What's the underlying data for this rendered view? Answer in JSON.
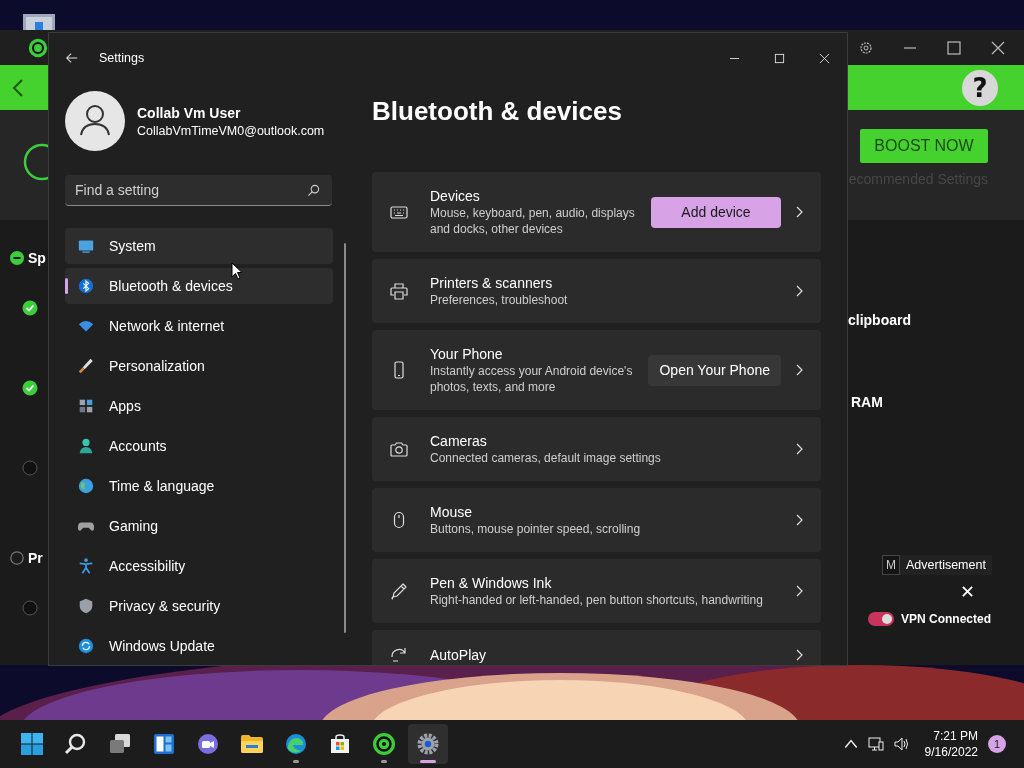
{
  "background_app": {
    "help": "?",
    "boost_button": "BOOST NOW",
    "recommended_link": "ecommended Settings",
    "sections": [
      {
        "label": "Sp",
        "indeterminate": true,
        "items": [
          {
            "checked": true
          },
          {
            "checked": true
          },
          {
            "checked": false
          }
        ]
      },
      {
        "label": "Pr",
        "indeterminate": false,
        "items": [
          {
            "checked": false
          }
        ]
      }
    ],
    "right_texts": [
      "clipboard",
      "RAM"
    ],
    "ad": {
      "label": "Advertisement",
      "button": "M"
    },
    "vpn": {
      "label": "VPN Connected",
      "on": true
    }
  },
  "settings_window": {
    "title": "Settings",
    "user": {
      "name": "Collab Vm User",
      "email": "CollabVmTimeVM0@outlook.com"
    },
    "search": {
      "placeholder": "Find a setting"
    },
    "nav": [
      {
        "label": "System",
        "selected": false,
        "hovered": true
      },
      {
        "label": "Bluetooth & devices",
        "selected": true,
        "hovered": false
      },
      {
        "label": "Network & internet",
        "selected": false,
        "hovered": false
      },
      {
        "label": "Personalization",
        "selected": false,
        "hovered": false
      },
      {
        "label": "Apps",
        "selected": false,
        "hovered": false
      },
      {
        "label": "Accounts",
        "selected": false,
        "hovered": false
      },
      {
        "label": "Time & language",
        "selected": false,
        "hovered": false
      },
      {
        "label": "Gaming",
        "selected": false,
        "hovered": false
      },
      {
        "label": "Accessibility",
        "selected": false,
        "hovered": false
      },
      {
        "label": "Privacy & security",
        "selected": false,
        "hovered": false
      },
      {
        "label": "Windows Update",
        "selected": false,
        "hovered": false
      }
    ],
    "heading": "Bluetooth & devices",
    "cards": [
      {
        "title": "Devices",
        "subtitle": "Mouse, keyboard, pen, audio, displays and docks, other devices",
        "button": {
          "label": "Add device",
          "kind": "accent"
        }
      },
      {
        "title": "Printers & scanners",
        "subtitle": "Preferences, troubleshoot"
      },
      {
        "title": "Your Phone",
        "subtitle": "Instantly access your Android device's photos, texts, and more",
        "button": {
          "label": "Open Your Phone",
          "kind": "standard"
        }
      },
      {
        "title": "Cameras",
        "subtitle": "Connected cameras, default image settings"
      },
      {
        "title": "Mouse",
        "subtitle": "Buttons, mouse pointer speed, scrolling"
      },
      {
        "title": "Pen & Windows Ink",
        "subtitle": "Right-handed or left-handed, pen button shortcuts, handwriting"
      },
      {
        "title": "AutoPlay"
      }
    ]
  },
  "taskbar": {
    "apps": [
      {
        "selected": false,
        "running": false
      },
      {
        "selected": false,
        "running": false
      },
      {
        "selected": false,
        "running": false
      },
      {
        "selected": false,
        "running": false
      },
      {
        "selected": false,
        "running": false
      },
      {
        "selected": false,
        "running": false
      },
      {
        "selected": false,
        "running": true
      },
      {
        "selected": false,
        "running": false
      },
      {
        "selected": false,
        "running": true
      },
      {
        "selected": true,
        "running": true
      }
    ],
    "time": "7:21 PM",
    "date": "9/16/2022",
    "notifications": "1"
  }
}
